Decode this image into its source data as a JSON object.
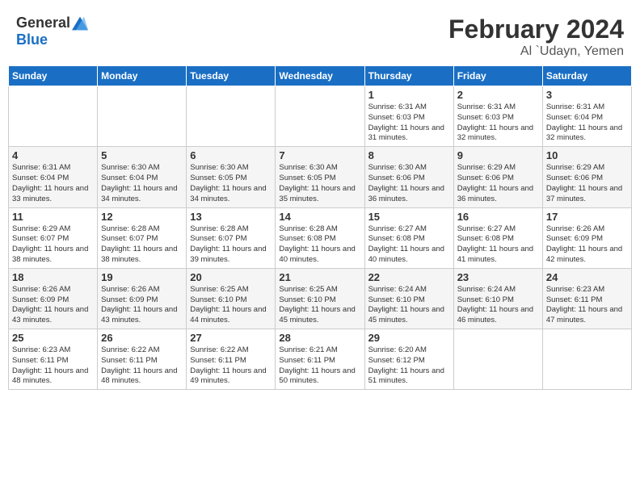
{
  "header": {
    "logo": {
      "general": "General",
      "blue": "Blue"
    },
    "month": "February 2024",
    "location": "Al `Udayn, Yemen"
  },
  "weekdays": [
    "Sunday",
    "Monday",
    "Tuesday",
    "Wednesday",
    "Thursday",
    "Friday",
    "Saturday"
  ],
  "weeks": [
    [
      {
        "day": "",
        "info": ""
      },
      {
        "day": "",
        "info": ""
      },
      {
        "day": "",
        "info": ""
      },
      {
        "day": "",
        "info": ""
      },
      {
        "day": "1",
        "info": "Sunrise: 6:31 AM\nSunset: 6:03 PM\nDaylight: 11 hours and 31 minutes."
      },
      {
        "day": "2",
        "info": "Sunrise: 6:31 AM\nSunset: 6:03 PM\nDaylight: 11 hours and 32 minutes."
      },
      {
        "day": "3",
        "info": "Sunrise: 6:31 AM\nSunset: 6:04 PM\nDaylight: 11 hours and 32 minutes."
      }
    ],
    [
      {
        "day": "4",
        "info": "Sunrise: 6:31 AM\nSunset: 6:04 PM\nDaylight: 11 hours and 33 minutes."
      },
      {
        "day": "5",
        "info": "Sunrise: 6:30 AM\nSunset: 6:04 PM\nDaylight: 11 hours and 34 minutes."
      },
      {
        "day": "6",
        "info": "Sunrise: 6:30 AM\nSunset: 6:05 PM\nDaylight: 11 hours and 34 minutes."
      },
      {
        "day": "7",
        "info": "Sunrise: 6:30 AM\nSunset: 6:05 PM\nDaylight: 11 hours and 35 minutes."
      },
      {
        "day": "8",
        "info": "Sunrise: 6:30 AM\nSunset: 6:06 PM\nDaylight: 11 hours and 36 minutes."
      },
      {
        "day": "9",
        "info": "Sunrise: 6:29 AM\nSunset: 6:06 PM\nDaylight: 11 hours and 36 minutes."
      },
      {
        "day": "10",
        "info": "Sunrise: 6:29 AM\nSunset: 6:06 PM\nDaylight: 11 hours and 37 minutes."
      }
    ],
    [
      {
        "day": "11",
        "info": "Sunrise: 6:29 AM\nSunset: 6:07 PM\nDaylight: 11 hours and 38 minutes."
      },
      {
        "day": "12",
        "info": "Sunrise: 6:28 AM\nSunset: 6:07 PM\nDaylight: 11 hours and 38 minutes."
      },
      {
        "day": "13",
        "info": "Sunrise: 6:28 AM\nSunset: 6:07 PM\nDaylight: 11 hours and 39 minutes."
      },
      {
        "day": "14",
        "info": "Sunrise: 6:28 AM\nSunset: 6:08 PM\nDaylight: 11 hours and 40 minutes."
      },
      {
        "day": "15",
        "info": "Sunrise: 6:27 AM\nSunset: 6:08 PM\nDaylight: 11 hours and 40 minutes."
      },
      {
        "day": "16",
        "info": "Sunrise: 6:27 AM\nSunset: 6:08 PM\nDaylight: 11 hours and 41 minutes."
      },
      {
        "day": "17",
        "info": "Sunrise: 6:26 AM\nSunset: 6:09 PM\nDaylight: 11 hours and 42 minutes."
      }
    ],
    [
      {
        "day": "18",
        "info": "Sunrise: 6:26 AM\nSunset: 6:09 PM\nDaylight: 11 hours and 43 minutes."
      },
      {
        "day": "19",
        "info": "Sunrise: 6:26 AM\nSunset: 6:09 PM\nDaylight: 11 hours and 43 minutes."
      },
      {
        "day": "20",
        "info": "Sunrise: 6:25 AM\nSunset: 6:10 PM\nDaylight: 11 hours and 44 minutes."
      },
      {
        "day": "21",
        "info": "Sunrise: 6:25 AM\nSunset: 6:10 PM\nDaylight: 11 hours and 45 minutes."
      },
      {
        "day": "22",
        "info": "Sunrise: 6:24 AM\nSunset: 6:10 PM\nDaylight: 11 hours and 45 minutes."
      },
      {
        "day": "23",
        "info": "Sunrise: 6:24 AM\nSunset: 6:10 PM\nDaylight: 11 hours and 46 minutes."
      },
      {
        "day": "24",
        "info": "Sunrise: 6:23 AM\nSunset: 6:11 PM\nDaylight: 11 hours and 47 minutes."
      }
    ],
    [
      {
        "day": "25",
        "info": "Sunrise: 6:23 AM\nSunset: 6:11 PM\nDaylight: 11 hours and 48 minutes."
      },
      {
        "day": "26",
        "info": "Sunrise: 6:22 AM\nSunset: 6:11 PM\nDaylight: 11 hours and 48 minutes."
      },
      {
        "day": "27",
        "info": "Sunrise: 6:22 AM\nSunset: 6:11 PM\nDaylight: 11 hours and 49 minutes."
      },
      {
        "day": "28",
        "info": "Sunrise: 6:21 AM\nSunset: 6:11 PM\nDaylight: 11 hours and 50 minutes."
      },
      {
        "day": "29",
        "info": "Sunrise: 6:20 AM\nSunset: 6:12 PM\nDaylight: 11 hours and 51 minutes."
      },
      {
        "day": "",
        "info": ""
      },
      {
        "day": "",
        "info": ""
      }
    ]
  ]
}
